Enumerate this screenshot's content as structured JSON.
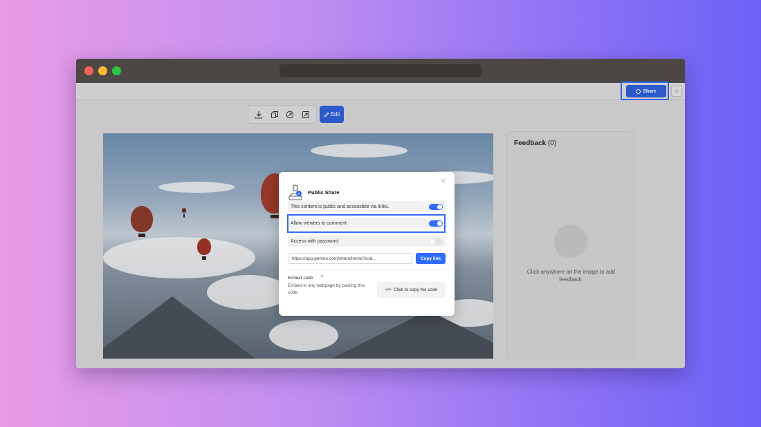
{
  "topbar": {
    "share_label": "Share",
    "accent_color": "#2f5fd9"
  },
  "toolbar": {
    "icons": [
      "download-icon",
      "copy-icon",
      "compress-icon",
      "expand-icon"
    ],
    "edit_label": "Edit"
  },
  "feedback": {
    "title": "Feedback",
    "count": "(0)",
    "hint": "Click anywhere on the image to add feedback."
  },
  "modal": {
    "title": "Public Share",
    "public_label": "This content is public and accessible via links.",
    "public_on": true,
    "comment_label": "Allow viewers to comment",
    "comment_on": true,
    "password_label": "Access with password",
    "password_on": false,
    "link_value": "https://app.gemoo.com/share/home?cod...",
    "copy_link_label": "Copy link",
    "embed_label": "Embed code",
    "embed_desc": "Embed in any webpage by pasting this code",
    "copy_code_label": "Click to copy the code"
  }
}
